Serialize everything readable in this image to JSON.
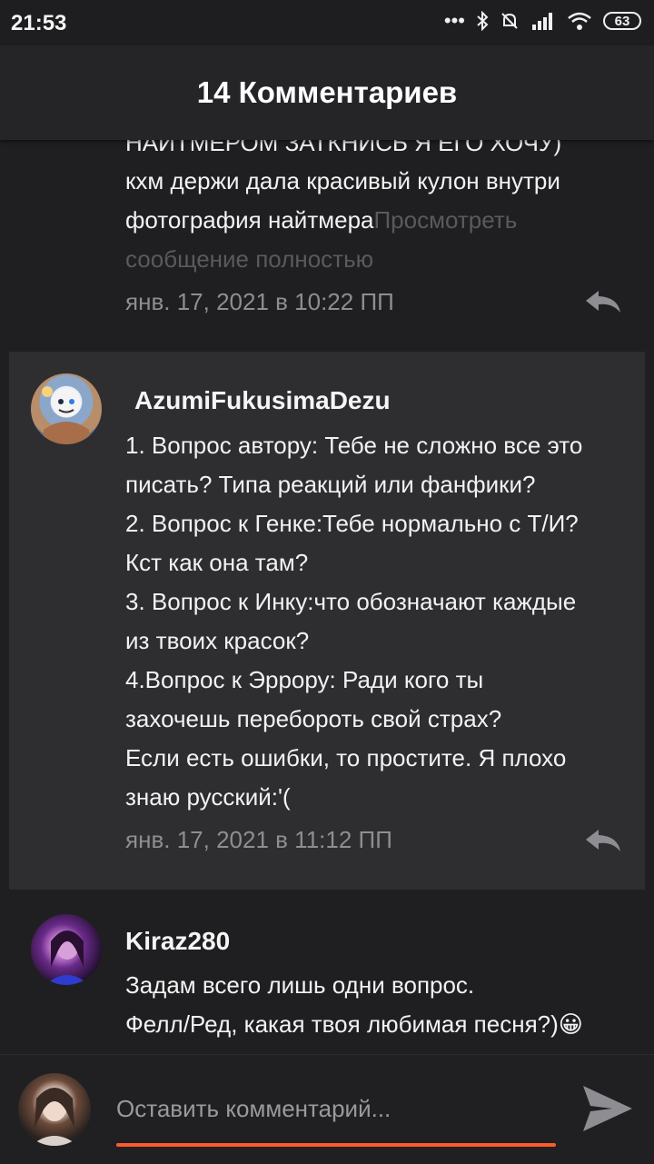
{
  "status": {
    "time": "21:53",
    "battery": "63"
  },
  "header": {
    "title": "14 Комментариев"
  },
  "comments": [
    {
      "cut_line": "НАЙТМЕРОМ ЗАТКНИСЬ Я ЕГО ХОЧУ)",
      "line1": "кхм держи дала красивый кулон внутри",
      "line2": "фотография найтмера",
      "more1": "Просмотреть",
      "more2": "сообщение полностью",
      "date": "янв. 17, 2021 в 10:22 ПП"
    },
    {
      "username": "AzumiFukusimaDezu",
      "lines": [
        "1. Вопрос автору: Тебе не сложно все это",
        "писать? Типа реакций или фанфики?",
        "2. Вопрос к Генке:Тебе нормально с Т/И?",
        "Кст как она там?",
        "3. Вопрос к Инку:что обозначают каждые",
        "из твоих красок?",
        "4.Вопрос к Эррору: Ради кого ты",
        "захочешь перебороть свой страх?",
        "Если есть ошибки, то простите. Я плохо",
        "знаю русский:'("
      ],
      "date": "янв. 17, 2021 в 11:12 ПП"
    },
    {
      "username": "Kiraz280",
      "lines": [
        "Задам всего лишь одни вопрос.",
        "Фелл/Ред, какая твоя любимая песня?)😀"
      ]
    }
  ],
  "composer": {
    "placeholder": "Оставить комментарий..."
  },
  "colors": {
    "accent": "#ff5a2b",
    "highlight_bg": "#2e2e31",
    "background": "#1f1f21"
  }
}
